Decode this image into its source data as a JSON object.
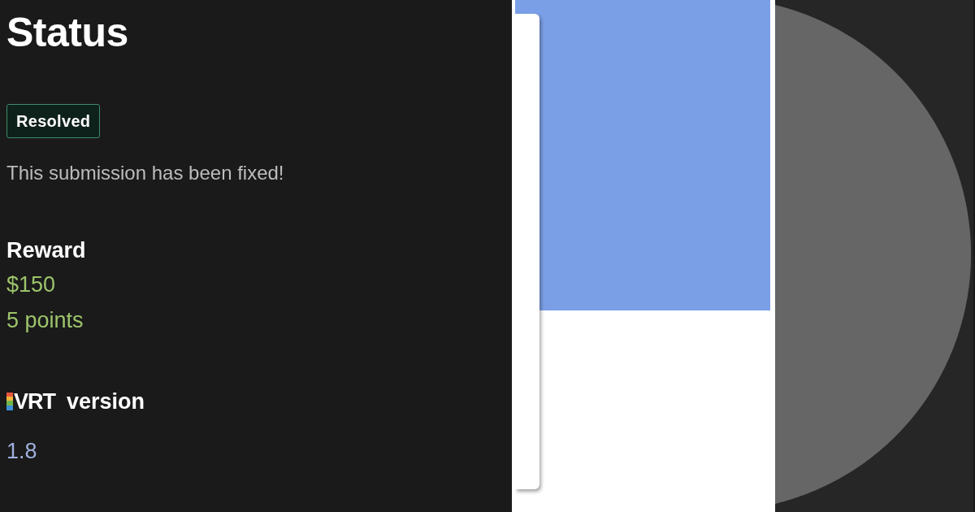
{
  "title": "Status",
  "status": {
    "label": "Resolved",
    "description": "This submission has been fixed!"
  },
  "reward": {
    "heading": "Reward",
    "amount": "$150",
    "points": "5 points"
  },
  "vrt": {
    "logo": "VRT",
    "heading": "version",
    "value": "1.8"
  }
}
